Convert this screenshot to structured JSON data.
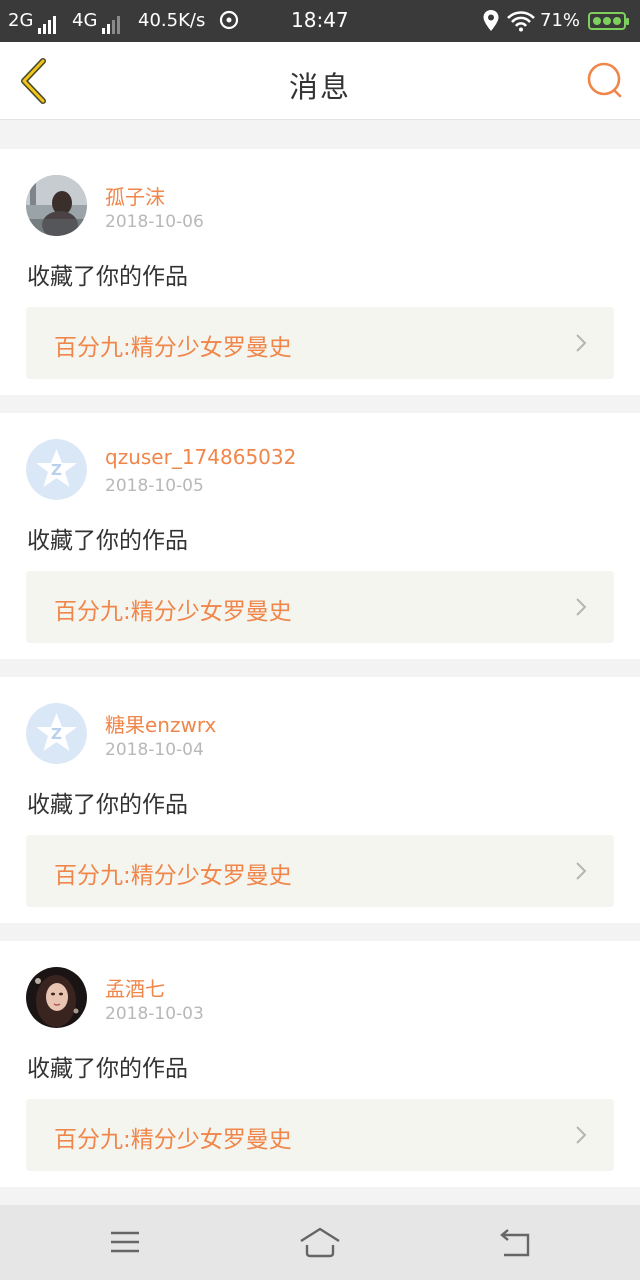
{
  "status_bar": {
    "network1": "2G",
    "network2": "4G",
    "speed": "40.5K/s",
    "time": "18:47",
    "battery": "71%",
    "battery_color": "#7ed05c"
  },
  "header": {
    "title": "消息",
    "back_icon": "chevron-left-icon",
    "search_icon": "search-icon"
  },
  "colors": {
    "accent": "#f0864a",
    "back_arrow": "#f0c419",
    "card_link_bg": "#f5f5f0"
  },
  "messages": [
    {
      "username": "孤子沫",
      "date": "2018-10-06",
      "action": "收藏了你的作品",
      "work": "百分九:精分少女罗曼史",
      "avatar": "photo-avatar"
    },
    {
      "username": "qzuser_174865032",
      "date": "2018-10-05",
      "action": "收藏了你的作品",
      "work": "百分九:精分少女罗曼史",
      "avatar": "qzone-default-avatar"
    },
    {
      "username": "糖果enzwrx",
      "date": "2018-10-04",
      "action": "收藏了你的作品",
      "work": "百分九:精分少女罗曼史",
      "avatar": "qzone-default-avatar"
    },
    {
      "username": "孟酒七",
      "date": "2018-10-03",
      "action": "收藏了你的作品",
      "work": "百分九:精分少女罗曼史",
      "avatar": "photo-avatar"
    }
  ],
  "nav_bar": {
    "menu_icon": "menu-icon",
    "home_icon": "home-icon",
    "back_icon": "return-icon"
  }
}
